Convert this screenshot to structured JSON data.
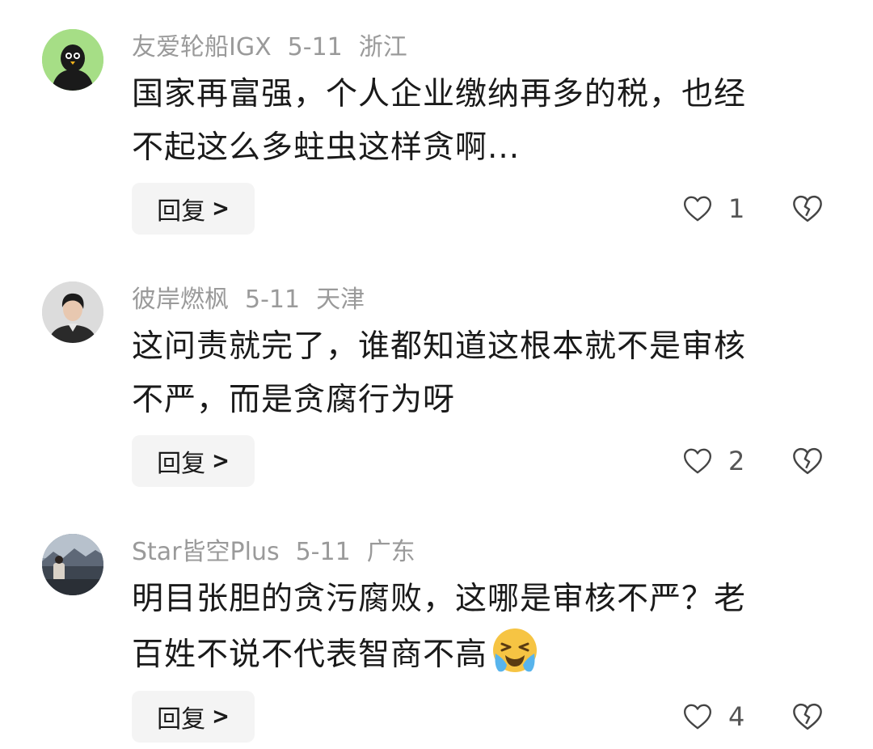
{
  "reply_label": "回复",
  "comments": [
    {
      "username": "友爱轮船IGX",
      "date": "5-11",
      "location": "浙江",
      "lines": [
        "国家再富强，个人企业缴纳再多的税，也经",
        "不起这么多蛀虫这样贪啊..."
      ],
      "likes": "1",
      "avatar": "bird-avatar"
    },
    {
      "username": "彼岸燃枫",
      "date": "5-11",
      "location": "天津",
      "lines": [
        "这问责就完了，谁都知道这根本就不是审核",
        "不严，而是贪腐行为呀"
      ],
      "likes": "2",
      "avatar": "person-avatar"
    },
    {
      "username": "Star皆空Plus",
      "date": "5-11",
      "location": "广东",
      "lines": [
        "明目张胆的贪污腐败，这哪是审核不严？老",
        "百姓不说不代表智商不高"
      ],
      "likes": "4",
      "avatar": "landscape-avatar",
      "trailing_emoji": "crying-laughing-emoji"
    }
  ],
  "colors": {
    "meta_text": "#9a9a9a",
    "body_text": "#1a1a1a",
    "reply_bg": "#f4f4f4",
    "avatar1_bg": "#a6de86"
  }
}
